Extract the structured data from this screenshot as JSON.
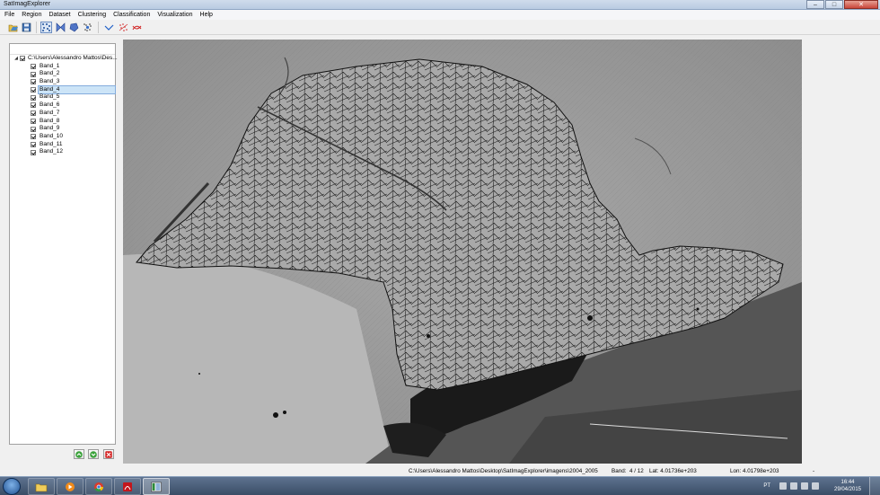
{
  "window": {
    "title": "SatImagExplorer"
  },
  "menu": [
    "File",
    "Region",
    "Dataset",
    "Clustering",
    "Classification",
    "Visualization",
    "Help"
  ],
  "toolbar": {
    "icons": [
      "open-icon",
      "save-icon",
      "points-icon",
      "bowtie-icon",
      "polygon-icon",
      "cluster-icon",
      "line-icon",
      "scatter-icon",
      "cross-line-icon"
    ]
  },
  "tree": {
    "root_label": "C:\\Users\\Alessandro Mattos\\Des...",
    "bands": [
      "Band_1",
      "Band_2",
      "Band_3",
      "Band_4",
      "Band_5",
      "Band_6",
      "Band_7",
      "Band_8",
      "Band_9",
      "Band_10",
      "Band_11",
      "Band_12"
    ],
    "selected": "Band_4"
  },
  "panel_buttons": [
    "move-up-icon",
    "move-down-icon",
    "remove-icon"
  ],
  "status": {
    "path": "C:\\Users\\Alessandro Mattos\\Desktop\\SatImagExplorer\\imagens\\2004_2005",
    "band_label": "Band:",
    "band_value": "4  /  12",
    "lat": "Lat:  4.01736e+203",
    "lon": "Lon:  4.01798e+203",
    "dash": "-"
  },
  "taskbar": {
    "apps": [
      "explorer-icon",
      "media-player-icon",
      "chrome-icon",
      "acrobat-icon",
      "satimagexplorer-icon"
    ],
    "lang": "PT",
    "time": "16:44",
    "date": "29/04/2015"
  },
  "colors": {
    "selection": "#cce4f7",
    "map_bg": "#9a9a9a",
    "taskbar": "#3a4d66"
  }
}
